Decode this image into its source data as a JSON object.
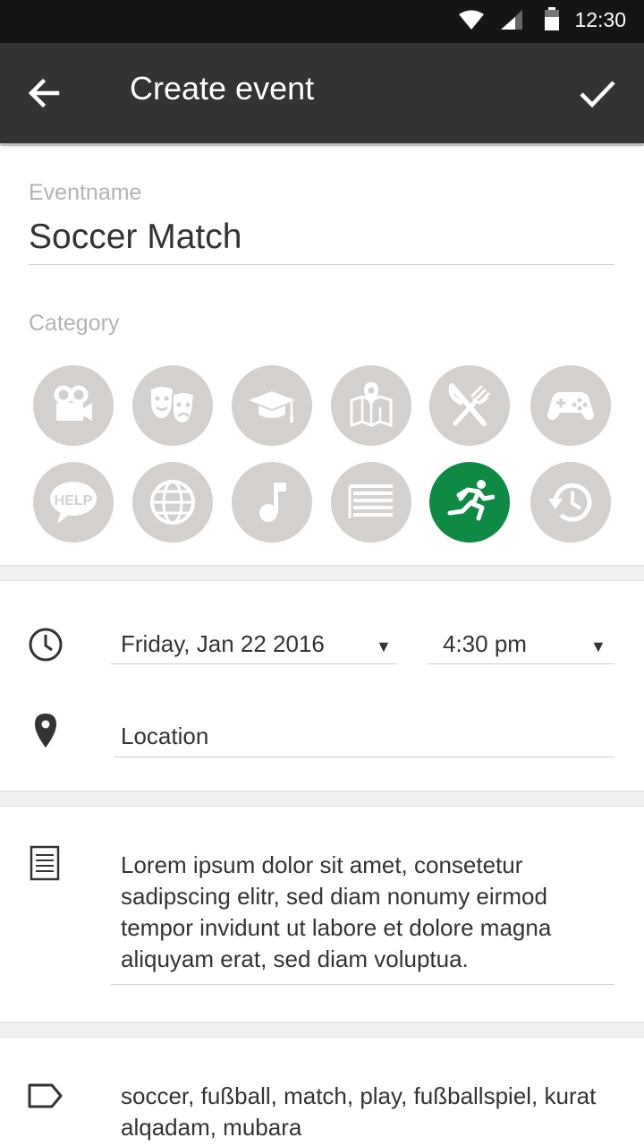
{
  "status_bar": {
    "time": "12:30"
  },
  "app_bar": {
    "title": "Create event"
  },
  "event_name": {
    "label": "Eventname",
    "value": "Soccer Match"
  },
  "category": {
    "label": "Category",
    "items": [
      {
        "name": "movies",
        "icon": "video-camera-icon"
      },
      {
        "name": "theater",
        "icon": "theater-masks-icon"
      },
      {
        "name": "education",
        "icon": "graduation-cap-icon"
      },
      {
        "name": "travel",
        "icon": "map-icon"
      },
      {
        "name": "food",
        "icon": "fork-knife-icon"
      },
      {
        "name": "games",
        "icon": "gamepad-icon"
      },
      {
        "name": "help",
        "icon": "help-bubble-icon",
        "text": "HELP"
      },
      {
        "name": "international",
        "icon": "globe-icon"
      },
      {
        "name": "music",
        "icon": "music-note-icon"
      },
      {
        "name": "list",
        "icon": "list-icon"
      },
      {
        "name": "sports",
        "icon": "running-person-icon",
        "selected": true
      },
      {
        "name": "history",
        "icon": "history-icon"
      }
    ],
    "active_color": "#0f8a45",
    "inactive_color": "#d3d0cd"
  },
  "datetime": {
    "date": "Friday, Jan 22 2016",
    "time": "4:30 pm"
  },
  "location": {
    "placeholder": "Location"
  },
  "description": {
    "text": "Lorem ipsum dolor sit amet, consetetur sadipscing elitr, sed diam nonumy eirmod tempor invidunt ut labore et dolore magna aliquyam erat, sed diam voluptua."
  },
  "tags": {
    "text": "soccer, fußball, match, play, fußballspiel, kurat alqadam, mubara"
  },
  "colors": {
    "app_bar": "#333333",
    "status_bar": "#151515",
    "accent": "#0f8a45"
  }
}
